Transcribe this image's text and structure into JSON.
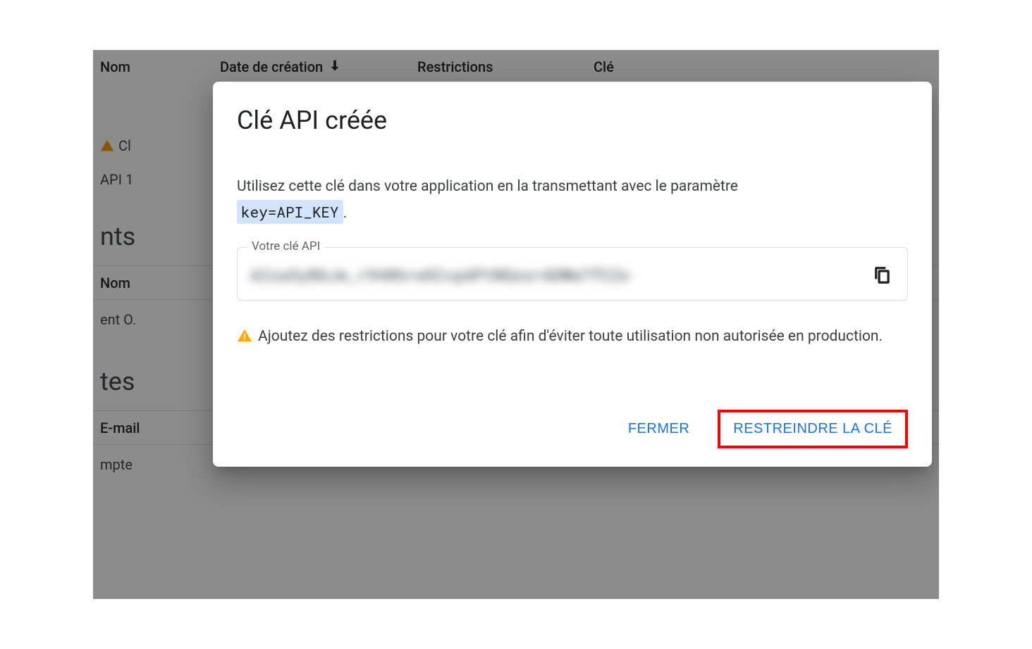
{
  "background": {
    "columns": {
      "name": "Nom",
      "date": "Date de création",
      "restrictions": "Restrictions",
      "key": "Clé"
    },
    "row1_fragment1": "Cl",
    "row1_fragment2": "API 1",
    "section1": "nts",
    "col_name2": "Nom",
    "row2": "ent O.",
    "section2": "tes",
    "col_email": "E-mail",
    "row3": "mpte"
  },
  "dialog": {
    "title": "Clé API créée",
    "description_pre": "Utilisez cette clé dans votre application en la transmettant avec le paramètre",
    "code": "key=API_KEY",
    "description_post": ".",
    "key_field_label": "Votre clé API",
    "key_value_masked": "AIzaSyBAJw_r9486re8lvpAPtNQsorADWw7fCZo",
    "warning_text": "Ajoutez des restrictions pour votre clé afin d'éviter toute utilisation non autorisée en production.",
    "close_label": "FERMER",
    "restrict_label": "RESTREINDRE LA CLÉ"
  }
}
